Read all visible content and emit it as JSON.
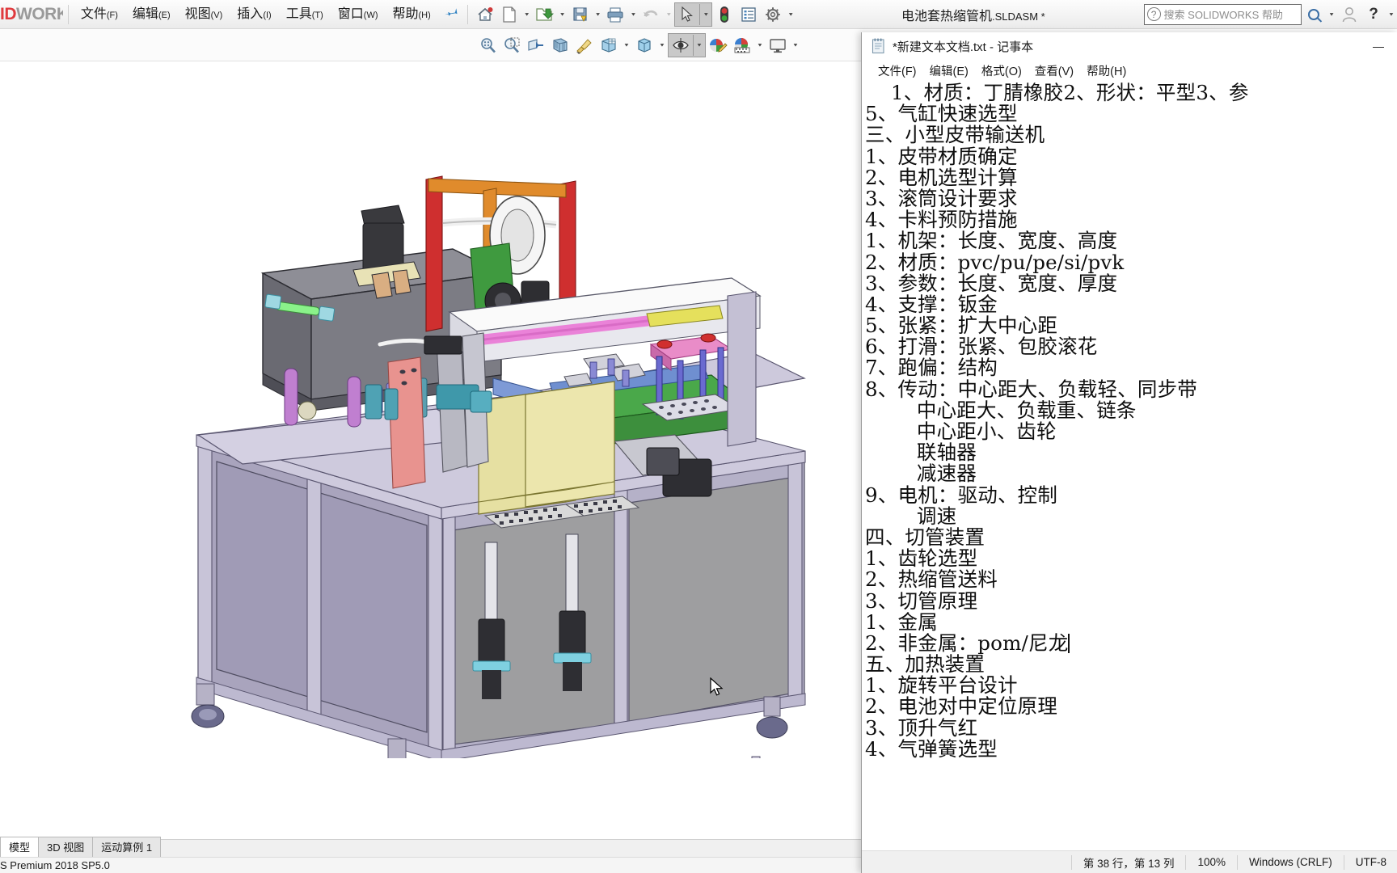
{
  "solidworks": {
    "logo_text": "IDWORKS",
    "menus": [
      {
        "label": "文件",
        "mn": "(F)",
        "name": "menu-file"
      },
      {
        "label": "编辑",
        "mn": "(E)",
        "name": "menu-edit"
      },
      {
        "label": "视图",
        "mn": "(V)",
        "name": "menu-view"
      },
      {
        "label": "插入",
        "mn": "(I)",
        "name": "menu-insert"
      },
      {
        "label": "工具",
        "mn": "(T)",
        "name": "menu-tools"
      },
      {
        "label": "窗口",
        "mn": "(W)",
        "name": "menu-window"
      },
      {
        "label": "帮助",
        "mn": "(H)",
        "name": "menu-help"
      }
    ],
    "pin_icon": "pushpin-icon",
    "toolbar1_icons": [
      "home-icon",
      "new-document-icon",
      "open-folder-icon",
      "save-icon",
      "print-icon",
      "undo-icon",
      "select-arrow-icon",
      "rebuild-icon",
      "options-list-icon",
      "settings-gear-icon"
    ],
    "toolbar2_icons": [
      "zoom-to-fit-icon",
      "zoom-to-area-icon",
      "section-view-icon",
      "view-orientation-icon",
      "apply-scene-icon",
      "display-style-icon",
      "hide-show-icon",
      "edit-appearance-icon",
      "scene-background-icon",
      "viewport-icon"
    ],
    "document_title": "电池套热缩管机",
    "document_ext": ".SLDASM *",
    "search": {
      "placeholder": "搜索 SOLIDWORKS 帮助",
      "icon": "help-question-icon"
    },
    "account_icon": "user-account-icon",
    "help_icon": "help-icon",
    "tabs": [
      {
        "label": "模型",
        "active": true
      },
      {
        "label": "3D 视图",
        "active": false
      },
      {
        "label": "运动算例 1",
        "active": false
      }
    ],
    "status_text": "S Premium 2018 SP5.0"
  },
  "notepad": {
    "title": "*新建文本文档.txt - 记事本",
    "icon": "notepad-icon",
    "window_buttons": [
      {
        "label": "—",
        "name": "minimize-button"
      }
    ],
    "menus": [
      {
        "label": "文件(F)",
        "name": "np-menu-file"
      },
      {
        "label": "编辑(E)",
        "name": "np-menu-edit"
      },
      {
        "label": "格式(O)",
        "name": "np-menu-format"
      },
      {
        "label": "查看(V)",
        "name": "np-menu-view"
      },
      {
        "label": "帮助(H)",
        "name": "np-menu-help"
      }
    ],
    "text_lines": [
      "    1、材质：丁腈橡胶2、形状：平型3、参",
      "5、气缸快速选型",
      "三、小型皮带输送机",
      "1、皮带材质确定",
      "2、电机选型计算",
      "3、滚筒设计要求",
      "4、卡料预防措施",
      "1、机架：长度、宽度、高度",
      "2、材质：pvc/pu/pe/si/pvk",
      "3、参数：长度、宽度、厚度",
      "4、支撑：钣金",
      "5、张紧：扩大中心距",
      "6、打滑：张紧、包胶滚花",
      "7、跑偏：结构",
      "8、传动：中心距大、负载轻、同步带",
      "        中心距大、负载重、链条",
      "        中心距小、齿轮",
      "        联轴器",
      "        减速器",
      "9、电机：驱动、控制",
      "        调速",
      "四、切管装置",
      "1、齿轮选型",
      "2、热缩管送料",
      "3、切管原理",
      "1、金属",
      "2、非金属：pom/尼龙",
      "五、加热装置",
      "1、旋转平台设计",
      "2、电池对中定位原理",
      "3、顶升气红",
      "4、气弹簧选型"
    ],
    "caret_line_index": 26,
    "status": {
      "position": "第 38 行，第 13 列",
      "zoom": "100%",
      "line_ending": "Windows (CRLF)",
      "encoding": "UTF-8"
    }
  },
  "colors": {
    "sw_red": "#e03a3e",
    "sw_gray": "#9a9a9a",
    "accent_blue": "#2a7fc1",
    "machine_frame": "#b8b4cc",
    "machine_panel_dark": "#6b6b73",
    "machine_green": "#3f8f3f",
    "machine_red_post": "#cc2b2b",
    "machine_orange": "#e08a2a",
    "machine_pink": "#e58fd0",
    "machine_yellow": "#e8e2a0",
    "machine_conveyor": "#4aa84a"
  }
}
